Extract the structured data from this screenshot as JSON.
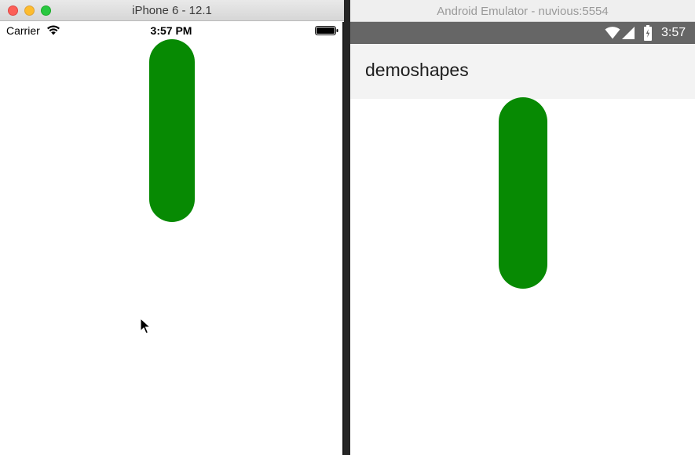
{
  "colors": {
    "shape_green": "#078a03",
    "ios_bg": "#ffffff",
    "android_status_bg": "#666666",
    "android_appbar_bg": "#f3f3f3"
  },
  "ios_simulator": {
    "window_title": "iPhone 6 - 12.1",
    "status_bar": {
      "carrier": "Carrier",
      "time": "3:57 PM",
      "wifi_icon": "wifi-icon",
      "battery_icon": "battery-icon"
    },
    "shape": {
      "kind": "rounded-rectangle",
      "color": "#078a03"
    }
  },
  "android_emulator": {
    "window_title": "Android Emulator - nuvious:5554",
    "status_bar": {
      "time": "3:57",
      "wifi_icon": "wifi-icon",
      "signal_icon": "cell-signal-icon",
      "battery_icon": "battery-icon"
    },
    "app_bar": {
      "title": "demoshapes"
    },
    "shape": {
      "kind": "rounded-rectangle",
      "color": "#078a03"
    }
  }
}
